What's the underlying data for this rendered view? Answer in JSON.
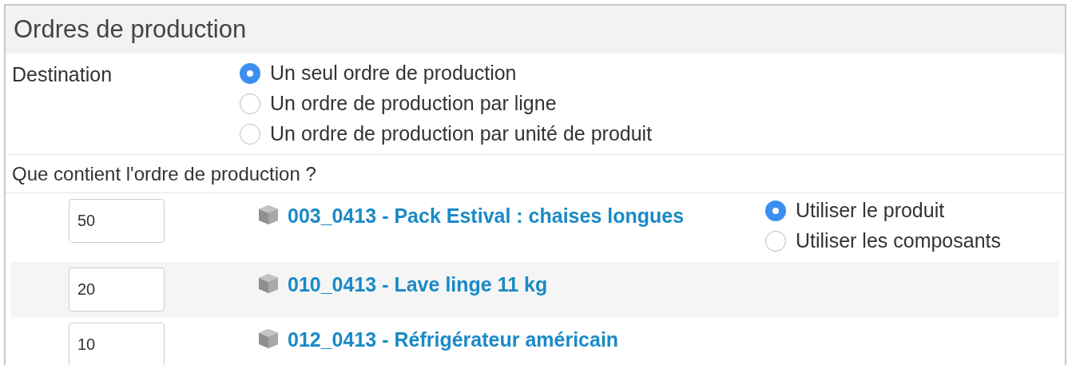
{
  "panel": {
    "title": "Ordres de production"
  },
  "destination": {
    "label": "Destination",
    "options": [
      {
        "label": "Un seul ordre de production",
        "selected": true
      },
      {
        "label": "Un ordre de production par ligne",
        "selected": false
      },
      {
        "label": "Un ordre de production par unité de produit",
        "selected": false
      }
    ]
  },
  "contents": {
    "label": "Que contient l'ordre de production ?"
  },
  "rows": [
    {
      "quantity": "50",
      "product": "003_0413 - Pack Estival : chaises longues",
      "options": [
        {
          "label": "Utiliser le produit",
          "selected": true
        },
        {
          "label": "Utiliser les composants",
          "selected": false
        }
      ]
    },
    {
      "quantity": "20",
      "product": "010_0413 - Lave linge 11 kg"
    },
    {
      "quantity": "10",
      "product": "012_0413 - Réfrigérateur américain"
    }
  ]
}
